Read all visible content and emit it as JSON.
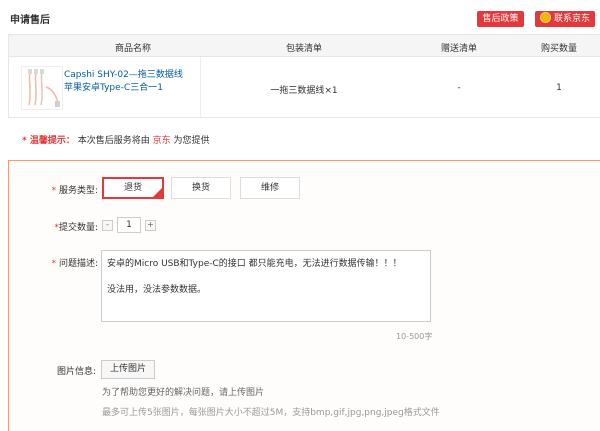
{
  "header": {
    "title": "申请售后",
    "policy_button": "售后政策",
    "contact_button": "联系京东"
  },
  "table": {
    "headers": [
      "商品名称",
      "包装清单",
      "赠送清单",
      "购买数量"
    ],
    "row": {
      "product_name": "Capshi SHY-02—拖三数据线 苹果安卓Type-C三合一1",
      "package": "一拖三数据线×1",
      "gift": "-",
      "quantity": "1"
    }
  },
  "notice": {
    "label": "* 温馨提示：",
    "text_before": "本次售后服务将由",
    "provider": "京东",
    "text_after": "为您提供"
  },
  "form": {
    "service_type": {
      "label": "服务类型:",
      "options": [
        "退货",
        "换货",
        "维修"
      ],
      "selected": "退货"
    },
    "quantity": {
      "label": "提交数量:",
      "minus": "-",
      "value": "1",
      "plus": "+"
    },
    "description": {
      "label": "问题描述:",
      "line1": "安卓的Micro USB和Type-C的接口 都只能充电，无法进行数据传输！！！",
      "line2": "没法用，没法参数数据。",
      "counter": "10-500字"
    },
    "images": {
      "label": "图片信息:",
      "upload_button": "上传图片",
      "hint": "为了帮助您更好的解决问题，请上传图片",
      "limit": "最多可上传5张图片，每张图片大小不超过5M，支持bmp,gif,jpg,png,jpeg格式文件"
    }
  },
  "colors": {
    "accent": "#e4393c",
    "link": "#005ea7",
    "form_border": "#ff9a66"
  }
}
